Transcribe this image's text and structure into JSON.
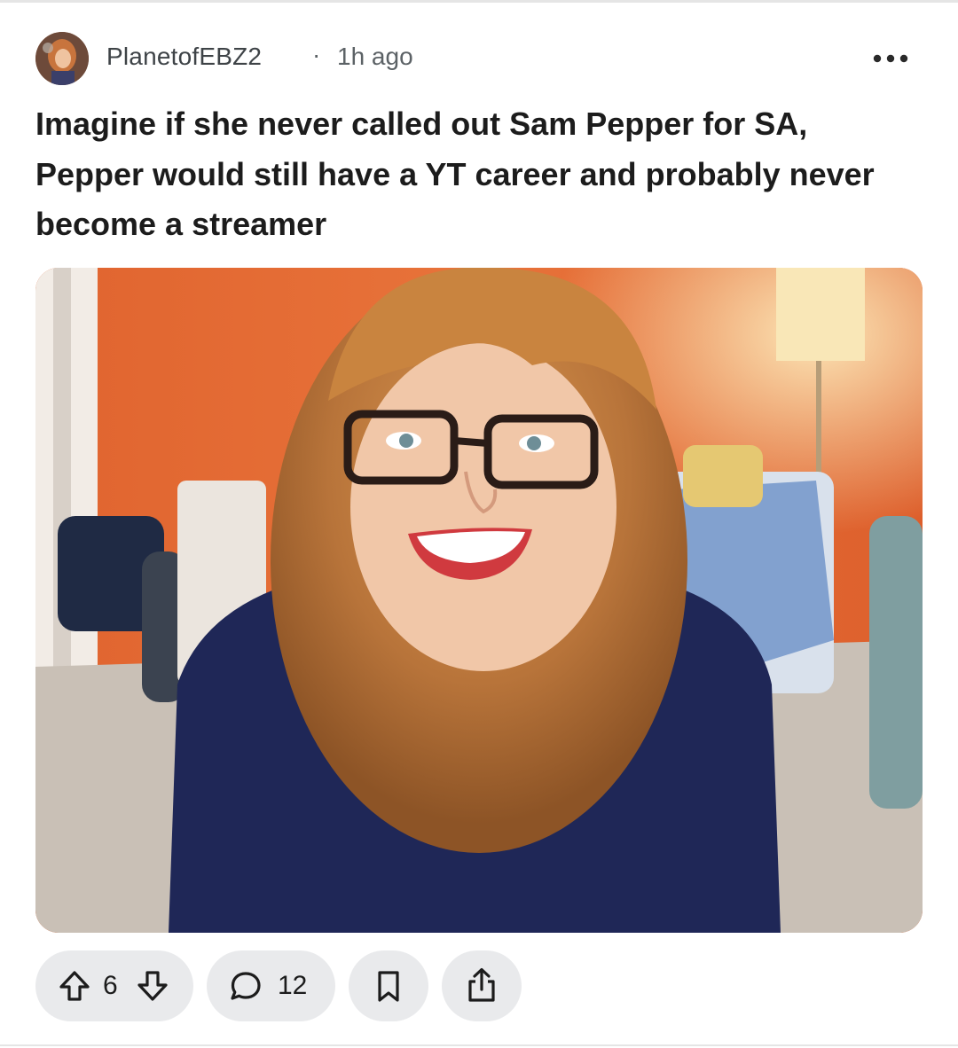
{
  "post": {
    "author": "PlanetofEBZ2",
    "separator": "·",
    "time_ago": "1h ago",
    "title": "Imagine if she never called out Sam Pepper for SA, Pepper would still have a YT career and probably never become a streamer"
  },
  "actions": {
    "vote_count": "6",
    "comment_count": "12"
  },
  "icons": {
    "more": "more-horizontal-icon",
    "upvote": "arrow-up-icon",
    "downvote": "arrow-down-icon",
    "comment": "speech-bubble-icon",
    "save": "bookmark-icon",
    "share": "share-icon"
  },
  "colors": {
    "text": "#1c1c1c",
    "meta_text": "#5c6266",
    "pill_bg": "#e9eaec",
    "divider": "#e5e5e5"
  }
}
